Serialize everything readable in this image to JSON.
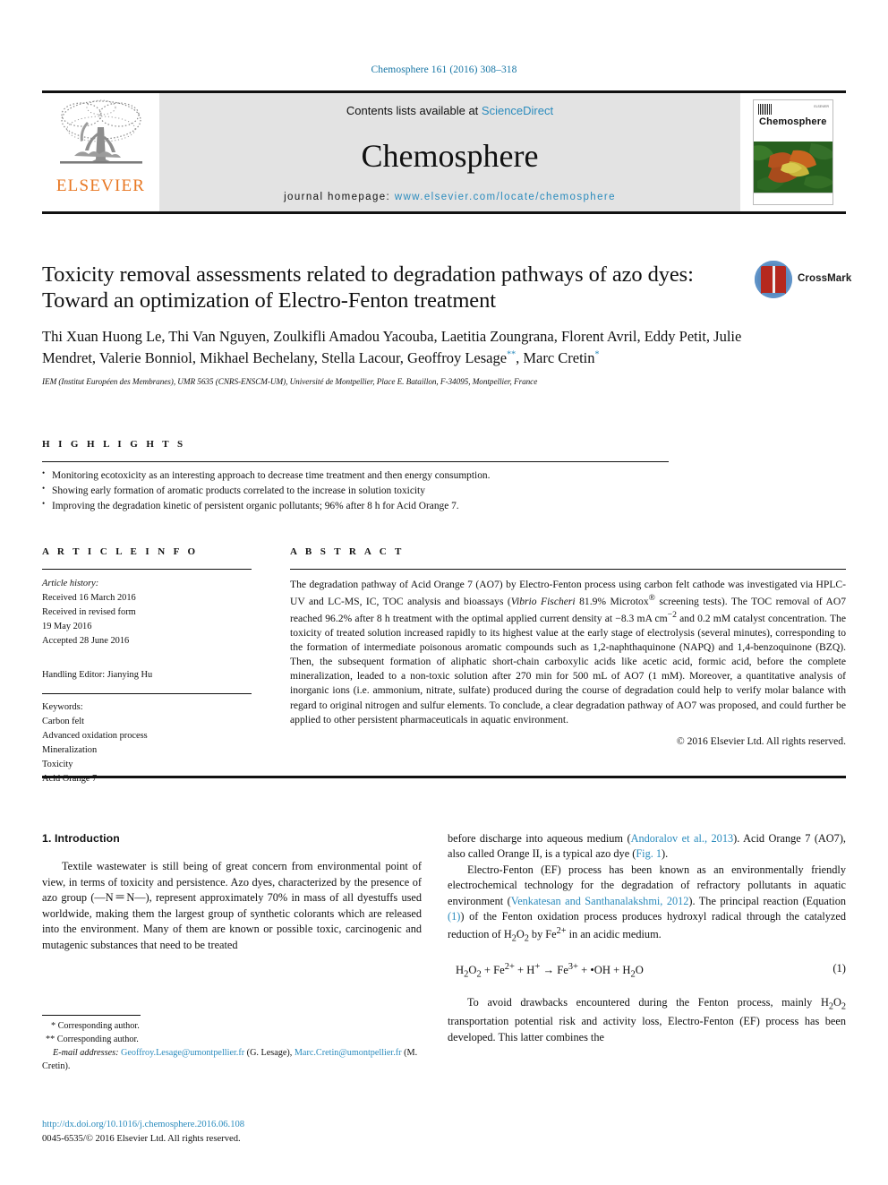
{
  "running_head": "Chemosphere 161 (2016) 308–318",
  "masthead": {
    "publisher_logo_text": "ELSEVIER",
    "contents_prefix": "Contents lists available at ",
    "contents_link": "ScienceDirect",
    "journal_name": "Chemosphere",
    "homepage_prefix": "journal homepage: ",
    "homepage_url": "www.elsevier.com/locate/chemosphere",
    "cover": {
      "journal_title": "Chemosphere",
      "corner_note": "ELSEVIER"
    }
  },
  "article": {
    "title": "Toxicity removal assessments related to degradation pathways of azo dyes: Toward an optimization of Electro-Fenton treatment",
    "authors": "Thi Xuan Huong Le, Thi Van Nguyen, Zoulkifli Amadou Yacouba, Laetitia Zoungrana, Florent Avril, Eddy Petit, Julie Mendret, Valerie Bonniol, Mikhael Bechelany, Stella Lacour, Geoffroy Lesage",
    "author_mark_1": "**",
    "authors_tail": ", Marc Cretin",
    "author_mark_2": "*",
    "affiliation": "IEM (Institut Européen des Membranes), UMR 5635 (CNRS-ENSCM-UM), Université de Montpellier, Place E. Bataillon, F-34095, Montpellier, France",
    "crossmark_label": "CrossMark"
  },
  "highlights": {
    "heading": "H I G H L I G H T S",
    "items": [
      "Monitoring ecotoxicity as an interesting approach to decrease time treatment and then energy consumption.",
      "Showing early formation of aromatic products correlated to the increase in solution toxicity",
      "Improving the degradation kinetic of persistent organic pollutants; 96% after 8 h for Acid Orange 7."
    ]
  },
  "article_info": {
    "heading": "A R T I C L E  I N F O",
    "history_label": "Article history:",
    "history_lines": [
      "Received 16 March 2016",
      "Received in revised form",
      "19 May 2016",
      "Accepted 28 June 2016"
    ],
    "handling_editor": "Handling Editor: Jianying Hu",
    "keywords_label": "Keywords:",
    "keywords": [
      "Carbon felt",
      "Advanced oxidation process",
      "Mineralization",
      "Toxicity",
      "Acid Orange 7"
    ]
  },
  "abstract": {
    "heading": "A B S T R A C T",
    "part1": "The degradation pathway of Acid Orange 7 (AO7) by Electro-Fenton process using carbon felt cathode was investigated via HPLC-UV and LC-MS, IC, TOC analysis and bioassays (",
    "italic1": "Vibrio Fischeri",
    "part2": " 81.9% Microtox",
    "sup1": "®",
    "part3": " screening tests). The TOC removal of AO7 reached 96.2% after 8 h treatment with the optimal applied current density at −8.3 mA cm",
    "sup2": "−2",
    "part4": " and 0.2 mM catalyst concentration. The toxicity of treated solution increased rapidly to its highest value at the early stage of electrolysis (several minutes), corresponding to the formation of intermediate poisonous aromatic compounds such as 1,2-naphthaquinone (NAPQ) and 1,4-benzoquinone (BZQ). Then, the subsequent formation of aliphatic short-chain carboxylic acids like acetic acid, formic acid, before the complete mineralization, leaded to a non-toxic solution after 270 min for 500 mL of AO7 (1 mM). Moreover, a quantitative analysis of inorganic ions (i.e. ammonium, nitrate, sulfate) produced during the course of degradation could help to verify molar balance with regard to original nitrogen and sulfur elements. To conclude, a clear degradation pathway of AO7 was proposed, and could further be applied to other persistent pharmaceuticals in aquatic environment.",
    "copyright": "© 2016 Elsevier Ltd. All rights reserved."
  },
  "body": {
    "section_heading": "1. Introduction",
    "left_p1": "Textile wastewater is still being of great concern from environmental point of view, in terms of toxicity and persistence. Azo dyes, characterized by the presence of azo group (—N＝N—), represent approximately 70% in mass of all dyestuffs used worldwide, making them the largest group of synthetic colorants which are released into the environment. Many of them are known or possible toxic, carcinogenic and mutagenic substances that need to be treated",
    "right_p1_a": "before discharge into aqueous medium (",
    "right_p1_ref1": "Andoralov et al., 2013",
    "right_p1_b": "). Acid Orange 7 (AO7), also called Orange II, is a typical azo dye (",
    "right_p1_ref2": "Fig. 1",
    "right_p1_c": ").",
    "right_p2_a": "Electro-Fenton (EF) process has been known as an environmentally friendly electrochemical technology for the degradation of refractory pollutants in aquatic environment (",
    "right_p2_ref1": "Venkatesan and Santhanalakshmi, 2012",
    "right_p2_b": "). The principal reaction (Equation ",
    "right_p2_ref2": "(1)",
    "right_p2_c": ") of the Fenton oxidation process produces hydroxyl radical through the catalyzed reduction of H",
    "right_p2_sub1": "2",
    "right_p2_d": "O",
    "right_p2_sub2": "2",
    "right_p2_e": " by Fe",
    "right_p2_sup1": "2+",
    "right_p2_f": " in an acidic medium.",
    "equation_number": "(1)",
    "right_p3_a": "To avoid drawbacks encountered during the Fenton process, mainly H",
    "right_p3_b": "O",
    "right_p3_c": " transportation potential risk and activity loss, Electro-Fenton (EF) process has been developed. This latter combines the"
  },
  "footnotes": {
    "mark1": "*",
    "line1": "Corresponding author.",
    "mark2": "**",
    "line2": "Corresponding author.",
    "email_label": "E-mail addresses:",
    "email1": "Geoffroy.Lesage@umontpellier.fr",
    "email1_owner": "(G. Lesage),",
    "email2": "Marc.Cretin@umontpellier.fr",
    "email2_owner": "(M. Cretin).",
    "doi": "http://dx.doi.org/10.1016/j.chemosphere.2016.06.108",
    "issn_line": "0045-6535/© 2016 Elsevier Ltd. All rights reserved."
  },
  "colors": {
    "link": "#2a8bbd",
    "running_head": "#1474a4",
    "elsevier_orange": "#E87722",
    "masthead_bg": "#e3e3e3"
  }
}
